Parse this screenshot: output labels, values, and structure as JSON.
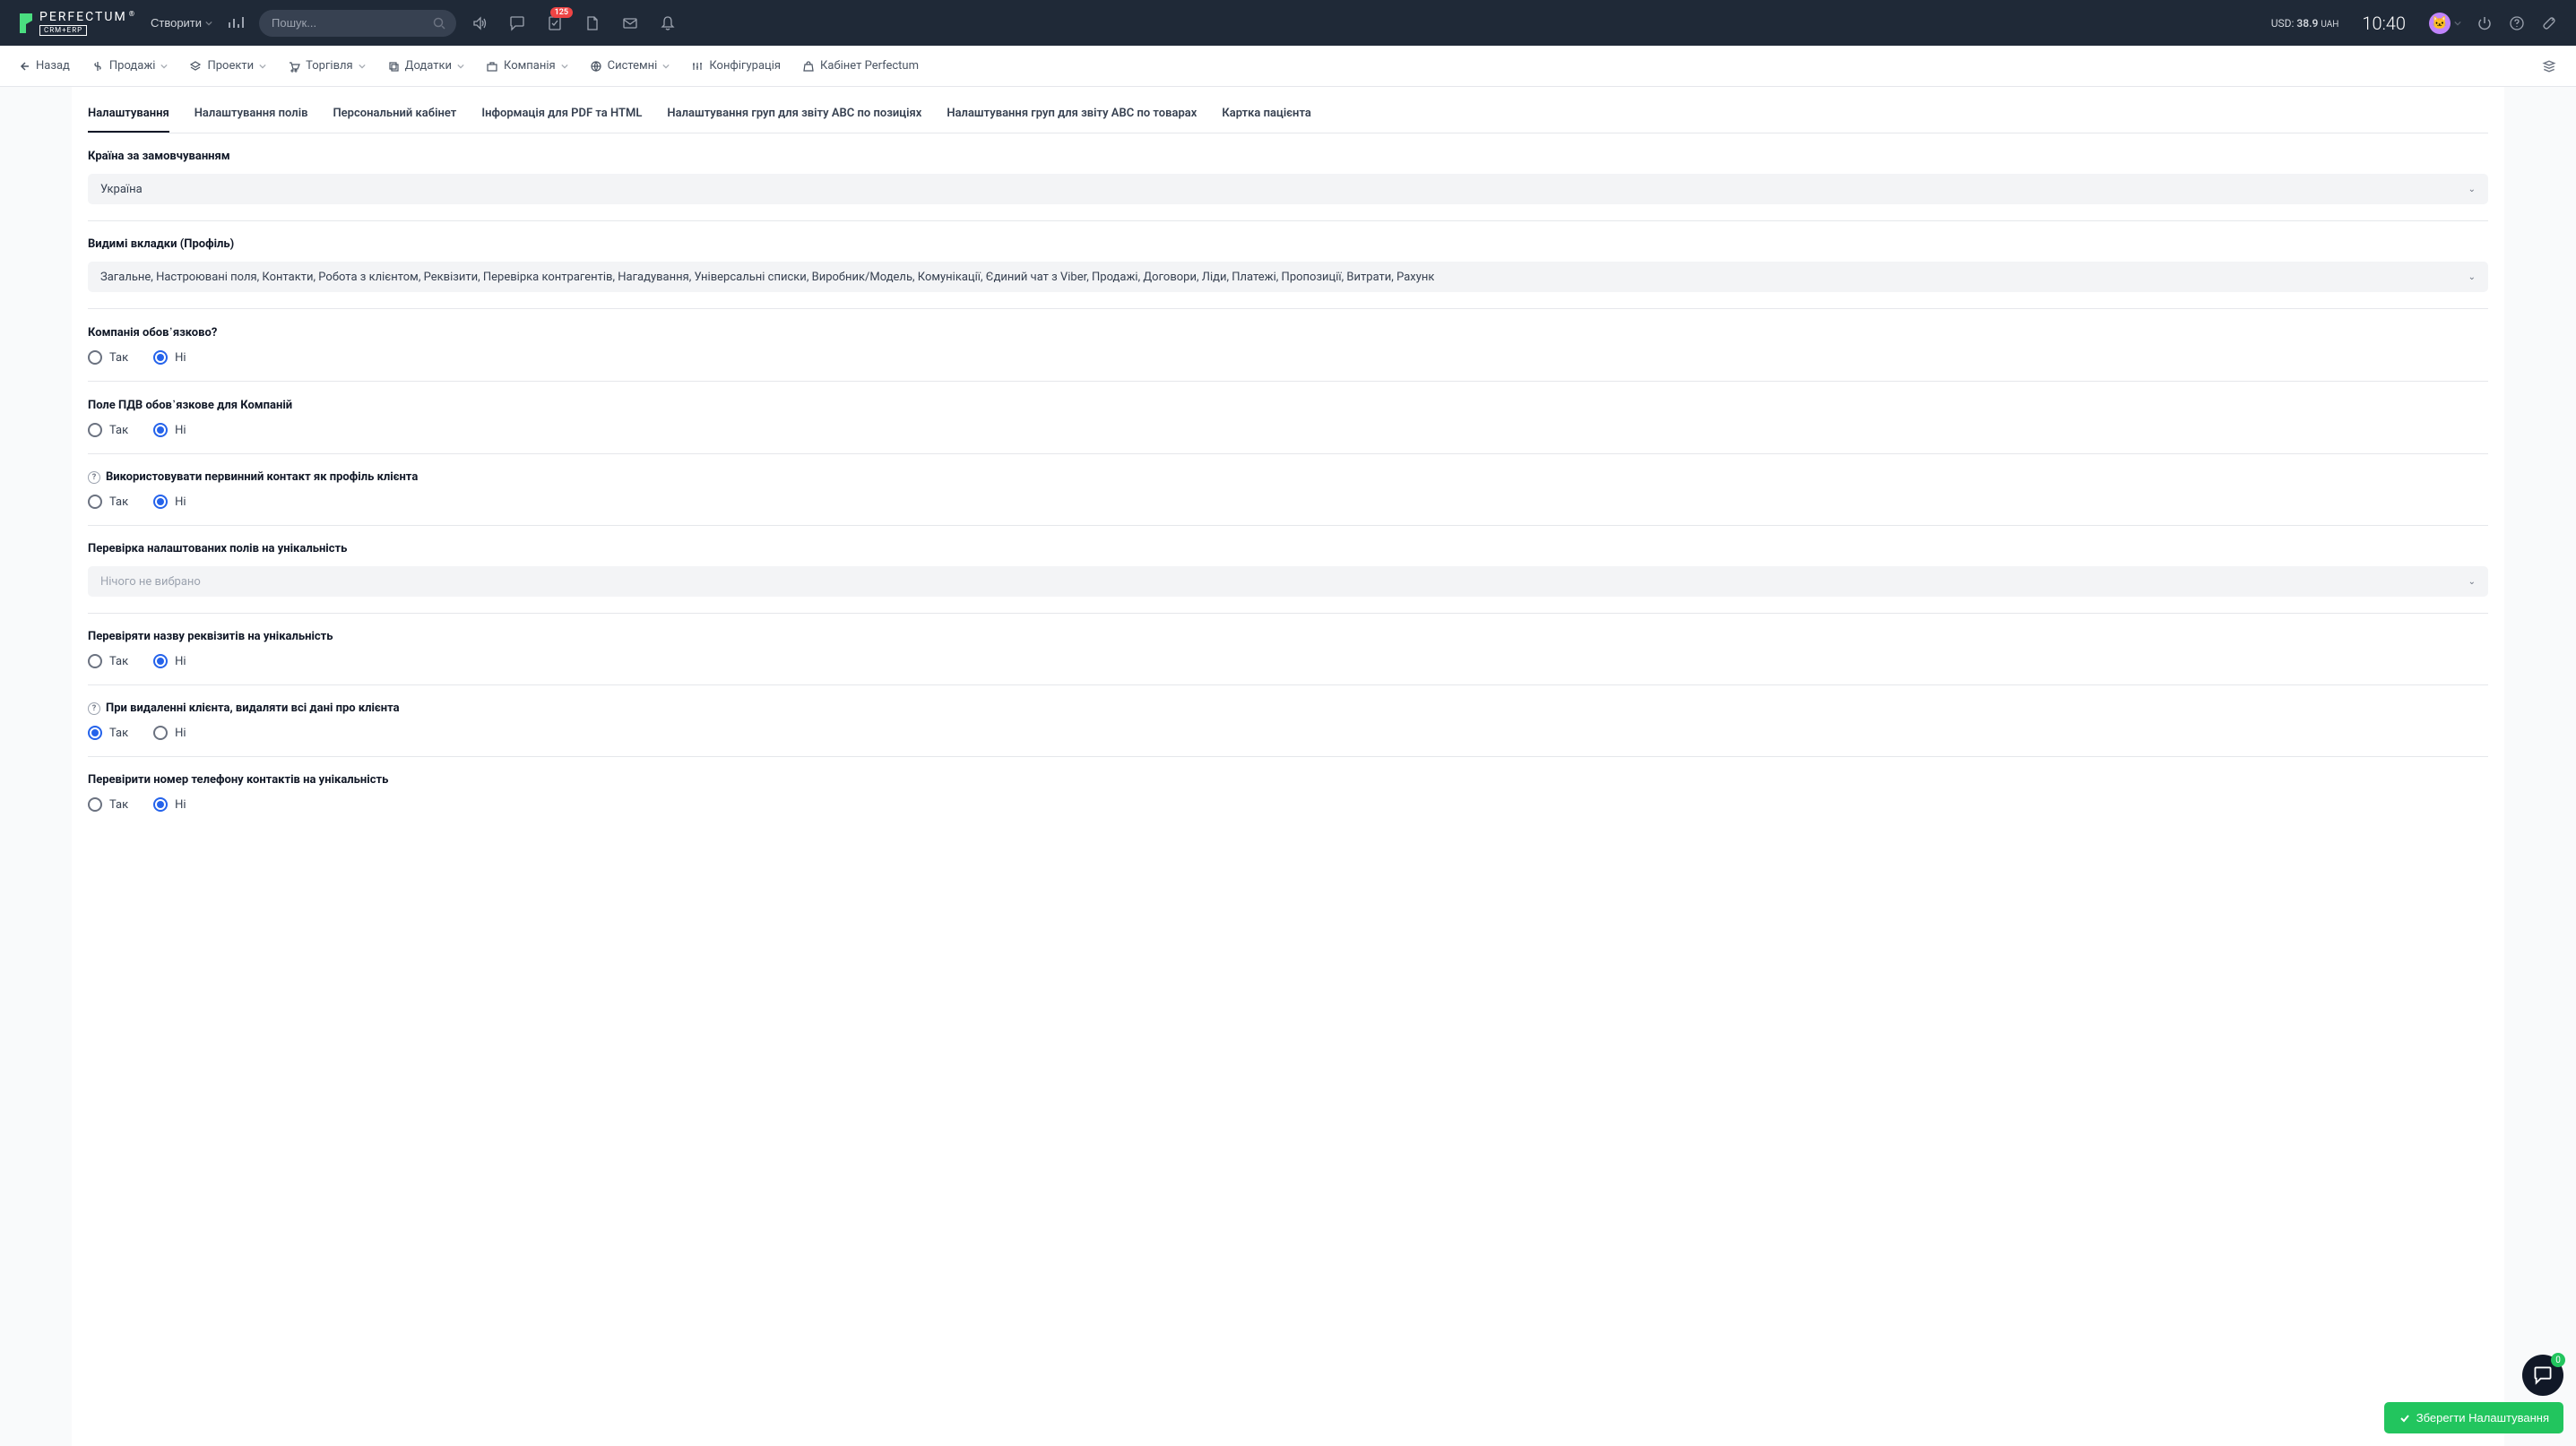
{
  "header": {
    "create_label": "Створити",
    "search_placeholder": "Пошук...",
    "badge_count": "125",
    "currency_prefix": "USD:",
    "currency_value": "38.9",
    "currency_suffix": "UAH",
    "clock": "10:40"
  },
  "nav": {
    "back": "Назад",
    "items": [
      "Продажі",
      "Проекти",
      "Торгівля",
      "Додатки",
      "Компанія",
      "Системні",
      "Конфігурація",
      "Кабінет Perfectum"
    ]
  },
  "tabs": [
    "Налаштування",
    "Налаштування полів",
    "Персональний кабінет",
    "Інформація для PDF та HTML",
    "Налаштування груп для звіту ABC по позиціях",
    "Налаштування груп для звіту ABC по товарах",
    "Картка пацієнта"
  ],
  "form": {
    "country_label": "Країна за замовчуванням",
    "country_value": "Україна",
    "visible_tabs_label": "Видимі вкладки (Профіль)",
    "visible_tabs_value": "Загальне, Настроювані поля, Контакти, Робота з клієнтом, Реквізити, Перевірка контрагентів, Нагадування, Універсальні списки, Виробник/Модель, Комунікації, Єдиний чат з Viber, Продажі, Договори, Ліди, Платежі, Пропозиції, Витрати, Рахунк",
    "company_required_label": "Компанія обов᾽язково?",
    "vat_required_label": "Поле ПДВ обов᾽язкове для Компаній",
    "primary_contact_label": "Використовувати первинний контакт як профіль клієнта",
    "unique_fields_label": "Перевірка налаштованих полів на унікальність",
    "unique_fields_placeholder": "Нічого не вибрано",
    "requisites_unique_label": "Перевіряти назву реквізитів на унікальність",
    "delete_data_label": "При видаленні клієнта, видаляти всі дані про клієнта",
    "phone_unique_label": "Перевірити номер телефону контактів на унікальність",
    "yes": "Так",
    "no": "Ні"
  },
  "save_button": "Зберегти Налаштування",
  "chat_badge": "0"
}
